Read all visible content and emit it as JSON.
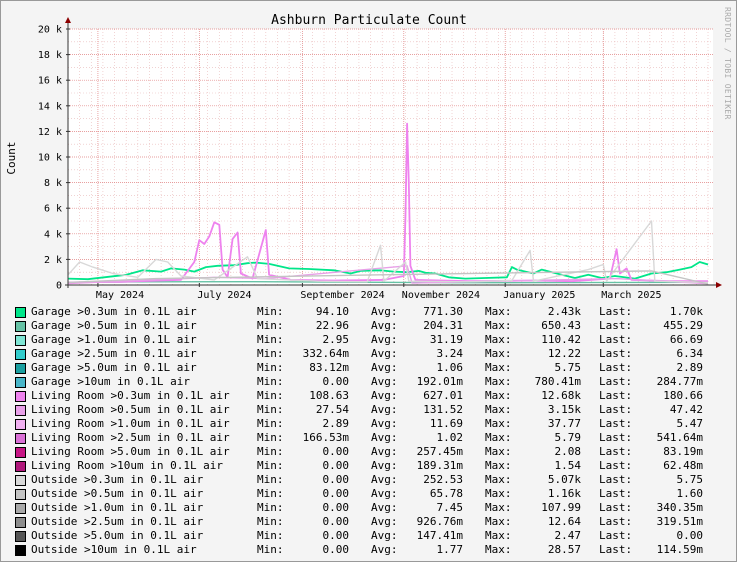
{
  "chart_data": {
    "type": "line",
    "title": "Ashburn Particulate Count",
    "ylabel": "Count",
    "watermark": "RRDTOOL / TOBI OETIKER",
    "ylim": [
      0,
      20000
    ],
    "yticks": [
      {
        "value": 0,
        "label": "0"
      },
      {
        "value": 2000,
        "label": "2 k"
      },
      {
        "value": 4000,
        "label": "4 k"
      },
      {
        "value": 6000,
        "label": "6 k"
      },
      {
        "value": 8000,
        "label": "8 k"
      },
      {
        "value": 10000,
        "label": "10 k"
      },
      {
        "value": 12000,
        "label": "12 k"
      },
      {
        "value": 14000,
        "label": "14 k"
      },
      {
        "value": 16000,
        "label": "16 k"
      },
      {
        "value": 18000,
        "label": "18 k"
      },
      {
        "value": 20000,
        "label": "20 k"
      }
    ],
    "xlim": [
      "2024-04-13",
      "2025-05-06"
    ],
    "xticks": [
      {
        "date": "2024-05-01",
        "label": "May 2024"
      },
      {
        "date": "2024-07-01",
        "label": "July 2024"
      },
      {
        "date": "2024-09-01",
        "label": "September 2024"
      },
      {
        "date": "2024-11-01",
        "label": "November 2024"
      },
      {
        "date": "2025-01-01",
        "label": "January 2025"
      },
      {
        "date": "2025-03-01",
        "label": "March 2025"
      }
    ],
    "grid": true,
    "series": [
      {
        "name": "Garage >0.3um in 0.1L air",
        "color": "#00e68a",
        "points": [
          [
            "2024-04-13",
            500
          ],
          [
            "2024-04-25",
            450
          ],
          [
            "2024-05-08",
            650
          ],
          [
            "2024-05-18",
            800
          ],
          [
            "2024-05-28",
            1150
          ],
          [
            "2024-06-08",
            1050
          ],
          [
            "2024-06-14",
            1300
          ],
          [
            "2024-06-22",
            1200
          ],
          [
            "2024-06-28",
            1050
          ],
          [
            "2024-07-05",
            1400
          ],
          [
            "2024-07-12",
            1500
          ],
          [
            "2024-07-22",
            1550
          ],
          [
            "2024-07-30",
            1700
          ],
          [
            "2024-08-04",
            1750
          ],
          [
            "2024-08-12",
            1650
          ],
          [
            "2024-08-24",
            1300
          ],
          [
            "2024-09-05",
            1250
          ],
          [
            "2024-09-20",
            1150
          ],
          [
            "2024-09-30",
            900
          ],
          [
            "2024-10-06",
            1100
          ],
          [
            "2024-10-18",
            1150
          ],
          [
            "2024-10-26",
            1050
          ],
          [
            "2024-11-03",
            1000
          ],
          [
            "2024-11-10",
            1100
          ],
          [
            "2024-11-14",
            950
          ],
          [
            "2024-11-20",
            900
          ],
          [
            "2024-11-28",
            600
          ],
          [
            "2024-12-08",
            500
          ],
          [
            "2024-12-20",
            550
          ],
          [
            "2025-01-02",
            600
          ],
          [
            "2025-01-05",
            1400
          ],
          [
            "2025-01-08",
            1200
          ],
          [
            "2025-01-18",
            900
          ],
          [
            "2025-01-23",
            1200
          ],
          [
            "2025-02-04",
            800
          ],
          [
            "2025-02-12",
            550
          ],
          [
            "2025-02-20",
            800
          ],
          [
            "2025-02-28",
            550
          ],
          [
            "2025-03-08",
            700
          ],
          [
            "2025-03-20",
            500
          ],
          [
            "2025-03-30",
            900
          ],
          [
            "2025-04-08",
            1000
          ],
          [
            "2025-04-16",
            1200
          ],
          [
            "2025-04-23",
            1400
          ],
          [
            "2025-04-28",
            1800
          ],
          [
            "2025-05-03",
            1600
          ]
        ]
      },
      {
        "name": "Garage >0.5um in 0.1L air",
        "color": "#66c2a5",
        "points": [
          [
            "2024-04-13",
            200
          ],
          [
            "2024-06-01",
            250
          ],
          [
            "2024-08-01",
            260
          ],
          [
            "2024-10-01",
            220
          ],
          [
            "2024-12-01",
            180
          ],
          [
            "2025-02-01",
            190
          ],
          [
            "2025-05-03",
            210
          ]
        ]
      },
      {
        "name": "Garage >1.0um in 0.1L air",
        "color": "#7fe5d4",
        "points": []
      },
      {
        "name": "Garage >2.5um in 0.1L air",
        "color": "#33cccc",
        "points": []
      },
      {
        "name": "Garage >5.0um in 0.1L air",
        "color": "#1a9fa0",
        "points": []
      },
      {
        "name": "Garage >10um in 0.1L air",
        "color": "#49b6c9",
        "points": []
      },
      {
        "name": "Living Room >0.3um in 0.1L air",
        "color": "#ee82ee",
        "points": [
          [
            "2024-04-13",
            200
          ],
          [
            "2024-05-15",
            250
          ],
          [
            "2024-06-20",
            400
          ],
          [
            "2024-06-28",
            1800
          ],
          [
            "2024-07-01",
            3500
          ],
          [
            "2024-07-04",
            3200
          ],
          [
            "2024-07-07",
            3800
          ],
          [
            "2024-07-10",
            4900
          ],
          [
            "2024-07-13",
            4700
          ],
          [
            "2024-07-15",
            1200
          ],
          [
            "2024-07-18",
            600
          ],
          [
            "2024-07-21",
            3600
          ],
          [
            "2024-07-24",
            4100
          ],
          [
            "2024-07-26",
            900
          ],
          [
            "2024-08-02",
            500
          ],
          [
            "2024-08-10",
            4300
          ],
          [
            "2024-08-12",
            800
          ],
          [
            "2024-08-25",
            400
          ],
          [
            "2024-09-20",
            350
          ],
          [
            "2024-10-20",
            400
          ],
          [
            "2024-11-01",
            700
          ],
          [
            "2024-11-02",
            5500
          ],
          [
            "2024-11-03",
            12600
          ],
          [
            "2024-11-04",
            8000
          ],
          [
            "2024-11-05",
            1500
          ],
          [
            "2024-11-08",
            400
          ],
          [
            "2024-12-10",
            300
          ],
          [
            "2025-01-20",
            350
          ],
          [
            "2025-02-10",
            300
          ],
          [
            "2025-03-05",
            500
          ],
          [
            "2025-03-09",
            2800
          ],
          [
            "2025-03-11",
            900
          ],
          [
            "2025-03-15",
            1300
          ],
          [
            "2025-03-18",
            400
          ],
          [
            "2025-04-10",
            300
          ],
          [
            "2025-05-03",
            300
          ]
        ]
      },
      {
        "name": "Living Room >0.5um in 0.1L air",
        "color": "#e8a0e8",
        "points": [
          [
            "2024-04-13",
            120
          ],
          [
            "2024-07-10",
            600
          ],
          [
            "2024-08-10",
            500
          ],
          [
            "2024-11-03",
            1500
          ],
          [
            "2024-11-06",
            150
          ],
          [
            "2025-03-09",
            500
          ],
          [
            "2025-05-03",
            100
          ]
        ]
      },
      {
        "name": "Living Room >1.0um in 0.1L air",
        "color": "#f0b0f0",
        "points": []
      },
      {
        "name": "Living Room >2.5um in 0.1L air",
        "color": "#da70d6",
        "points": []
      },
      {
        "name": "Living Room >5.0um in 0.1L air",
        "color": "#c71585",
        "points": []
      },
      {
        "name": "Living Room >10um in 0.1L air",
        "color": "#b0177b",
        "points": []
      },
      {
        "name": "Outside >0.3um in 0.1L air",
        "color": "#d8d8d8",
        "points": [
          [
            "2024-04-13",
            800
          ],
          [
            "2024-04-20",
            1800
          ],
          [
            "2024-04-28",
            1400
          ],
          [
            "2024-05-10",
            900
          ],
          [
            "2024-05-25",
            600
          ],
          [
            "2024-06-05",
            2000
          ],
          [
            "2024-06-12",
            1800
          ],
          [
            "2024-06-20",
            700
          ],
          [
            "2024-07-10",
            400
          ],
          [
            "2024-07-30",
            2200
          ],
          [
            "2024-08-05",
            500
          ],
          [
            "2024-09-10",
            300
          ],
          [
            "2024-10-10",
            250
          ],
          [
            "2024-10-18",
            3100
          ],
          [
            "2024-10-20",
            300
          ],
          [
            "2024-11-02",
            1800
          ],
          [
            "2024-11-04",
            300
          ],
          [
            "2024-12-10",
            250
          ],
          [
            "2025-01-05",
            350
          ],
          [
            "2025-01-16",
            2700
          ],
          [
            "2025-01-18",
            300
          ],
          [
            "2025-02-20",
            1200
          ],
          [
            "2025-03-01",
            1600
          ],
          [
            "2025-03-03",
            300
          ],
          [
            "2025-03-30",
            5000
          ],
          [
            "2025-04-01",
            300
          ],
          [
            "2025-05-03",
            200
          ]
        ]
      },
      {
        "name": "Outside >0.5um in 0.1L air",
        "color": "#c4c4c4",
        "points": [
          [
            "2024-04-13",
            200
          ],
          [
            "2024-06-05",
            500
          ],
          [
            "2024-10-18",
            800
          ],
          [
            "2025-03-30",
            1100
          ],
          [
            "2025-05-03",
            80
          ]
        ]
      },
      {
        "name": "Outside >1.0um in 0.1L air",
        "color": "#a8a8a8",
        "points": []
      },
      {
        "name": "Outside >2.5um in 0.1L air",
        "color": "#8c8c8c",
        "points": []
      },
      {
        "name": "Outside >5.0um in 0.1L air",
        "color": "#555555",
        "points": []
      },
      {
        "name": "Outside >10um in 0.1L air",
        "color": "#000000",
        "points": []
      }
    ]
  },
  "legend": {
    "labels": {
      "min": "Min:",
      "avg": "Avg:",
      "max": "Max:",
      "last": "Last:"
    },
    "rows": [
      {
        "name": "Garage >0.3um in 0.1L air",
        "min": "94.10",
        "avg": "771.30",
        "max": "2.43k",
        "last": "1.70k"
      },
      {
        "name": "Garage >0.5um in 0.1L air",
        "min": "22.96",
        "avg": "204.31",
        "max": "650.43",
        "last": "455.29"
      },
      {
        "name": "Garage >1.0um in 0.1L air",
        "min": "2.95",
        "avg": "31.19",
        "max": "110.42",
        "last": "66.69"
      },
      {
        "name": "Garage >2.5um in 0.1L air",
        "min": "332.64m",
        "avg": "3.24",
        "max": "12.22",
        "last": "6.34"
      },
      {
        "name": "Garage >5.0um in 0.1L air",
        "min": "83.12m",
        "avg": "1.06",
        "max": "5.75",
        "last": "2.89"
      },
      {
        "name": "Garage >10um in 0.1L air",
        "min": "0.00",
        "avg": "192.01m",
        "max": "780.41m",
        "last": "284.77m"
      },
      {
        "name": "Living Room >0.3um in 0.1L air",
        "min": "108.63",
        "avg": "627.01",
        "max": "12.68k",
        "last": "180.66"
      },
      {
        "name": "Living Room >0.5um in 0.1L air",
        "min": "27.54",
        "avg": "131.52",
        "max": "3.15k",
        "last": "47.42"
      },
      {
        "name": "Living Room >1.0um in 0.1L air",
        "min": "2.89",
        "avg": "11.69",
        "max": "37.77",
        "last": "5.47"
      },
      {
        "name": "Living Room >2.5um in 0.1L air",
        "min": "166.53m",
        "avg": "1.02",
        "max": "5.79",
        "last": "541.64m"
      },
      {
        "name": "Living Room >5.0um in 0.1L air",
        "min": "0.00",
        "avg": "257.45m",
        "max": "2.08",
        "last": "83.19m"
      },
      {
        "name": "Living Room >10um in 0.1L air",
        "min": "0.00",
        "avg": "189.31m",
        "max": "1.54",
        "last": "62.48m"
      },
      {
        "name": "Outside >0.3um in 0.1L air",
        "min": "0.00",
        "avg": "252.53",
        "max": "5.07k",
        "last": "5.75"
      },
      {
        "name": "Outside >0.5um in 0.1L air",
        "min": "0.00",
        "avg": "65.78",
        "max": "1.16k",
        "last": "1.60"
      },
      {
        "name": "Outside >1.0um in 0.1L air",
        "min": "0.00",
        "avg": "7.45",
        "max": "107.99",
        "last": "340.35m"
      },
      {
        "name": "Outside >2.5um in 0.1L air",
        "min": "0.00",
        "avg": "926.76m",
        "max": "12.64",
        "last": "319.51m"
      },
      {
        "name": "Outside >5.0um in 0.1L air",
        "min": "0.00",
        "avg": "147.41m",
        "max": "2.47",
        "last": "0.00"
      },
      {
        "name": "Outside >10um in 0.1L air",
        "min": "0.00",
        "avg": "1.77",
        "max": "28.57",
        "last": "114.59m"
      }
    ]
  }
}
